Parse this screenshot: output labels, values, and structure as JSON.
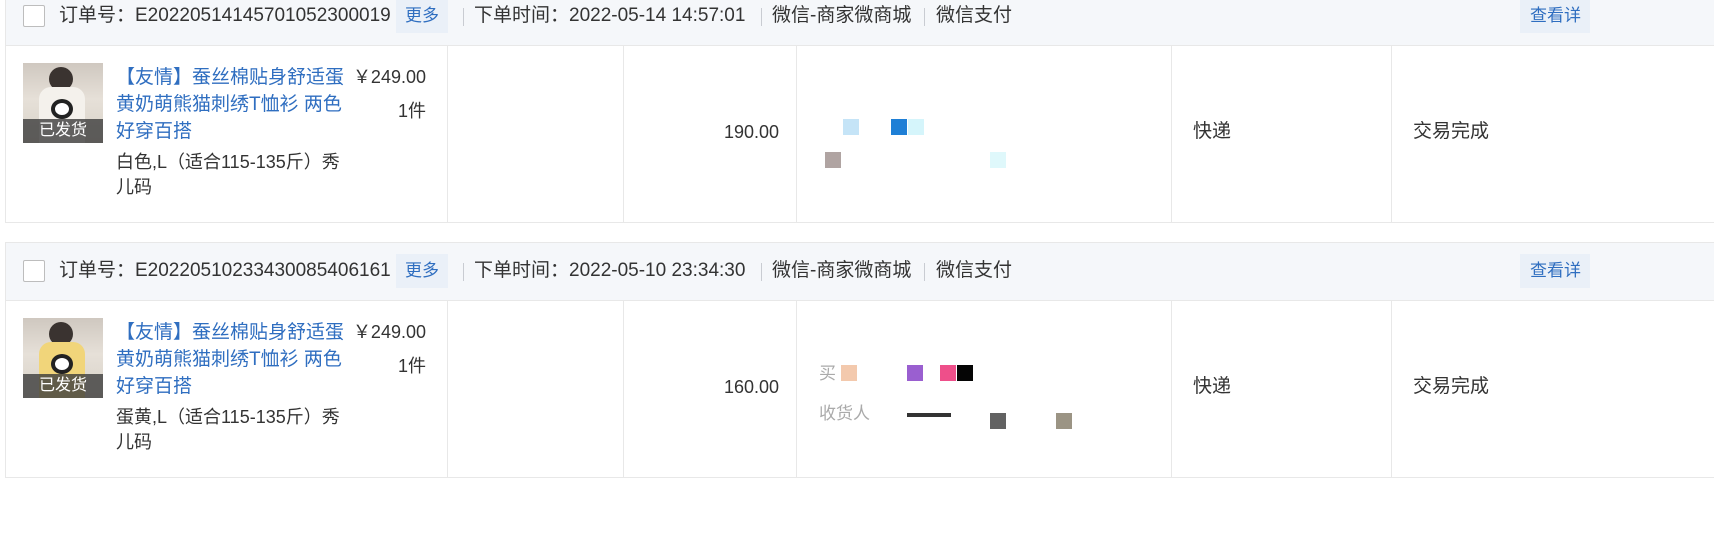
{
  "orders": [
    {
      "order_no_label": "订单号：E20220514145701052300019",
      "more_label": "更多",
      "time_label": "下单时间：2022-05-14 14:57:01",
      "channel": "微信-商家微商城",
      "payment": "微信支付",
      "view_label": "查看详",
      "product": {
        "shipped_badge": "已发货",
        "title": "【友情】蚕丝棉贴身舒适蛋黄奶萌熊猫刺绣T恤衫 两色好穿百搭",
        "spec": "白色,L（适合115-135斤）秀儿码",
        "price": "￥249.00",
        "quantity": "1件"
      },
      "amount": "190.00",
      "shipping": "快递",
      "status": "交易完成",
      "thumb_color": "#f4f1ec"
    },
    {
      "order_no_label": "订单号：E20220510233430085406161",
      "more_label": "更多",
      "time_label": "下单时间：2022-05-10 23:34:30",
      "channel": "微信-商家微商城",
      "payment": "微信支付",
      "view_label": "查看详",
      "product": {
        "shipped_badge": "已发货",
        "title": "【友情】蚕丝棉贴身舒适蛋黄奶萌熊猫刺绣T恤衫 两色好穿百搭",
        "spec": "蛋黄,L（适合115-135斤）秀儿码",
        "price": "￥249.00",
        "quantity": "1件"
      },
      "amount": "160.00",
      "buyer_partial": "买",
      "receiver_partial": "收货人",
      "shipping": "快递",
      "status": "交易完成",
      "thumb_color": "#f1d57a"
    }
  ],
  "colors": {
    "link": "#2f6ec0",
    "header_bg": "#f5f7fa",
    "border": "#e8e8e8"
  }
}
